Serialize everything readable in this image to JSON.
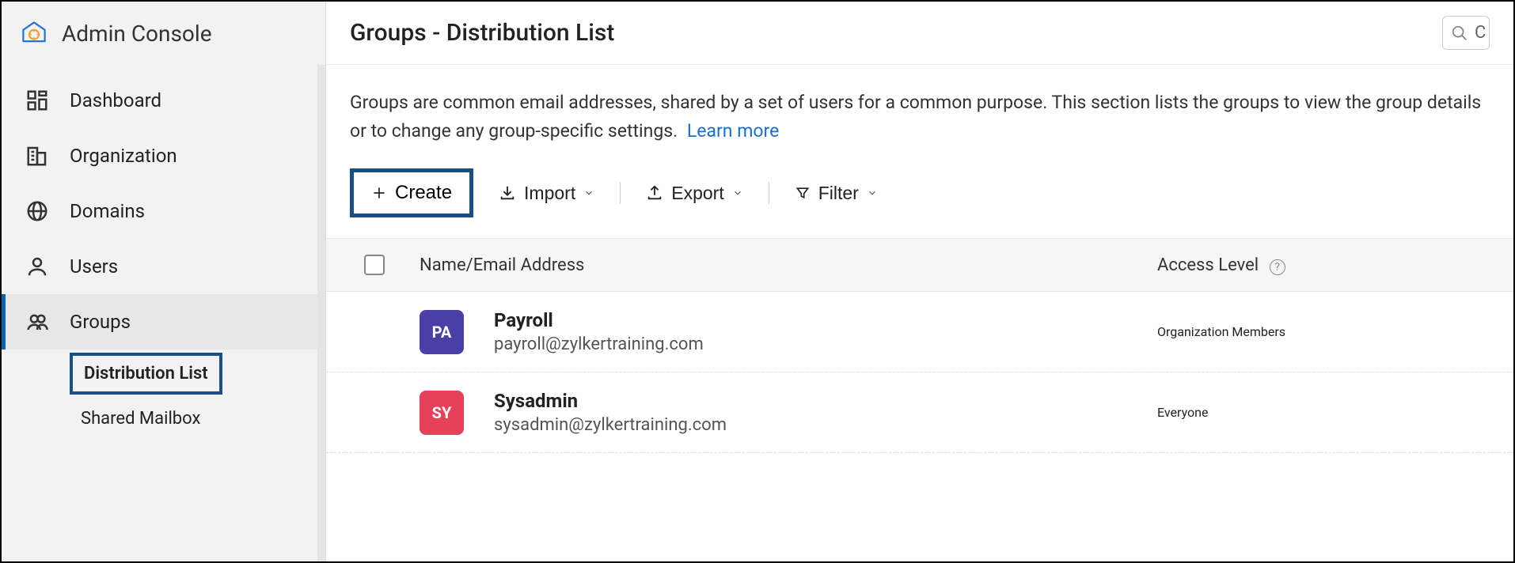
{
  "sidebar": {
    "app_title": "Admin Console",
    "items": [
      {
        "label": "Dashboard"
      },
      {
        "label": "Organization"
      },
      {
        "label": "Domains"
      },
      {
        "label": "Users"
      },
      {
        "label": "Groups"
      }
    ],
    "subitems": [
      {
        "label": "Distribution List"
      },
      {
        "label": "Shared Mailbox"
      }
    ]
  },
  "header": {
    "title": "Groups - Distribution List"
  },
  "description": {
    "text": "Groups are common email addresses, shared by a set of users for a common purpose. This section lists the groups to view the group details or to change any group-specific settings.",
    "learn_more": "Learn more"
  },
  "toolbar": {
    "create": "Create",
    "import": "Import",
    "export": "Export",
    "filter": "Filter"
  },
  "table": {
    "columns": {
      "name": "Name/Email Address",
      "access": "Access Level"
    },
    "rows": [
      {
        "initials": "PA",
        "name": "Payroll",
        "email": "payroll@zylkertraining.com",
        "access": "Organization Members",
        "avatar_class": "pa"
      },
      {
        "initials": "SY",
        "name": "Sysadmin",
        "email": "sysadmin@zylkertraining.com",
        "access": "Everyone",
        "avatar_class": "sy"
      }
    ]
  }
}
